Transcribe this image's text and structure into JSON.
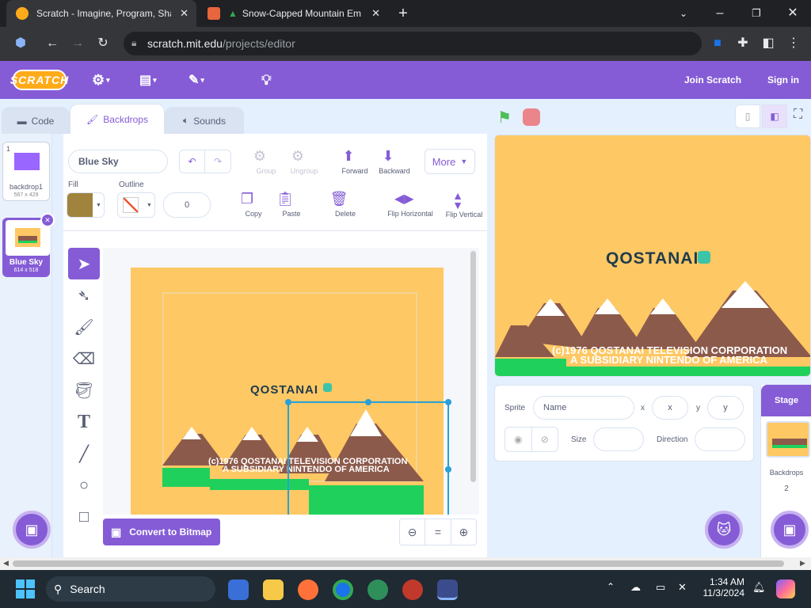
{
  "browser": {
    "tabs": [
      {
        "title": "Scratch - Imagine, Program, Sha",
        "active": true
      },
      {
        "title": "Snow-Capped Mountain Em",
        "active": false
      }
    ],
    "new_tab": "+",
    "url_host": "scratch.mit.edu",
    "url_path": "/projects/editor",
    "window_controls": [
      "chevron-down-icon",
      "minimize-icon",
      "restore-icon",
      "close-icon"
    ]
  },
  "menubar": {
    "logo": "SCRATCH",
    "join": "Join Scratch",
    "signin": "Sign in"
  },
  "editor_tabs": [
    {
      "label": "Code",
      "icon": "code-icon",
      "active": false
    },
    {
      "label": "Backdrops",
      "icon": "brush-icon",
      "active": true
    },
    {
      "label": "Sounds",
      "icon": "speaker-icon",
      "active": false
    }
  ],
  "costumes": [
    {
      "index": "1",
      "name": "backdrop1",
      "size": "567 x 429",
      "selected": false
    },
    {
      "index": "2",
      "name": "Blue Sky",
      "size": "614 x 518",
      "selected": true
    }
  ],
  "paint": {
    "costume_name": "Blue Sky",
    "fill_label": "Fill",
    "outline_label": "Outline",
    "outline_width": "0",
    "fill_color": "#a0843d",
    "group": "Group",
    "ungroup": "Ungroup",
    "forward": "Forward",
    "backward": "Backward",
    "more": "More",
    "copy": "Copy",
    "paste": "Paste",
    "delete": "Delete",
    "flip_h": "Flip Horizontal",
    "flip_v": "Flip Vertical",
    "convert": "Convert to Bitmap",
    "zoom_reset": "="
  },
  "artwork": {
    "brand": "QOSTANAI",
    "line1": "(c)1976 QOSTANAI TELEVISION CORPORATION",
    "line2": "A SUBSIDIARY NINTENDO OF AMERICA"
  },
  "sprite_info": {
    "sprite_label": "Sprite",
    "name_placeholder": "Name",
    "x_label": "x",
    "x_placeholder": "x",
    "y_label": "y",
    "y_placeholder": "y",
    "size_label": "Size",
    "direction_label": "Direction"
  },
  "stage_pane": {
    "title": "Stage",
    "backdrops_label": "Backdrops",
    "backdrops_count": "2"
  },
  "taskbar": {
    "search": "Search",
    "time": "1:34 AM",
    "date": "11/3/2024"
  },
  "colors": {
    "scratch_purple": "#855cd6",
    "stage_bg": "#fec864",
    "mountain": "#8c5a4b",
    "snow": "#ffffff",
    "grass": "#1fd15c",
    "brand_text": "#1f3b4d",
    "brand_accent": "#3bc4a8"
  }
}
